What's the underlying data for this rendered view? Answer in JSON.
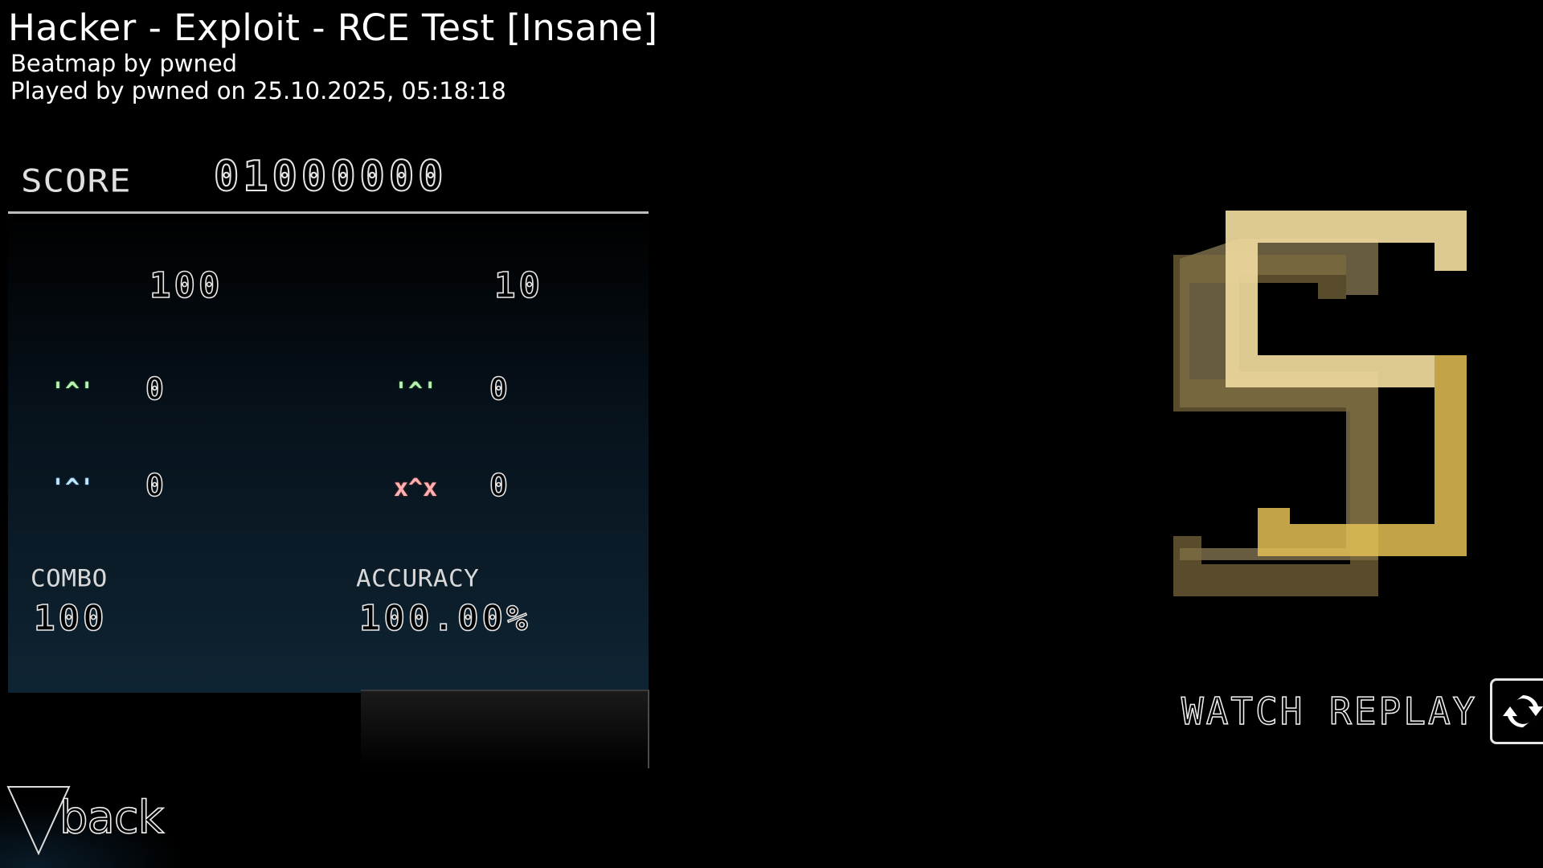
{
  "header": {
    "title": "Hacker - Exploit - RCE Test [Insane]",
    "creator": "Beatmap by pwned",
    "played": "Played by pwned on 25.10.2025, 05:18:18"
  },
  "score": {
    "label": "SCORE",
    "value": "01000000"
  },
  "stats": {
    "left_total": "100",
    "right_total": "10",
    "judgements": [
      {
        "glyph": "'^'",
        "count": "0",
        "color": "#b8f0b0"
      },
      {
        "glyph": "'^'",
        "count": "0",
        "color": "#b8f0b0"
      },
      {
        "glyph": "'^'",
        "count": "0",
        "color": "#bfe8ff"
      },
      {
        "glyph": "x^x",
        "count": "0",
        "color": "#ffb0b0"
      }
    ],
    "combo_label": "COMBO",
    "combo_value": "100",
    "accuracy_label": "ACCURACY",
    "accuracy_value": "100.00%"
  },
  "grade": {
    "letter": "S",
    "colors": {
      "front": "#e8c35a",
      "back": "#8a7a55",
      "highlight": "#f5eccc"
    }
  },
  "actions": {
    "replay_label": "WATCH REPLAY",
    "replay_icon": "refresh-icon",
    "back_label": "back"
  }
}
